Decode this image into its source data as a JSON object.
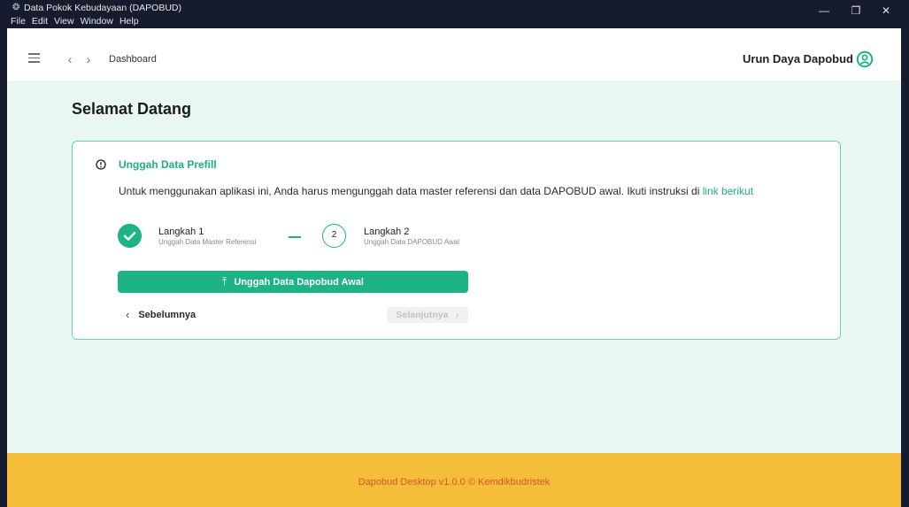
{
  "window": {
    "title": "Data Pokok Kebudayaan (DAPOBUD)",
    "menu": [
      "File",
      "Edit",
      "View",
      "Window",
      "Help"
    ],
    "controls": {
      "minimize_icon": "—",
      "restore_icon": "❐",
      "close_icon": "✕"
    }
  },
  "header": {
    "breadcrumb": "Dashboard",
    "user_label": "Urun Daya Dapobud",
    "icons": {
      "menu": "hamburger-icon",
      "back": "‹",
      "forward": "›",
      "user": "user-circle-icon"
    }
  },
  "main": {
    "title": "Selamat Datang",
    "card": {
      "title": "Unggah Data Prefill",
      "description": "Untuk menggunakan aplikasi ini, Anda harus mengunggah data master referensi dan data DAPOBUD awal. Ikuti instruksi di ",
      "link_text": "link berikut",
      "steps": [
        {
          "label": "Langkah 1",
          "sub": "Unggah Data Master Referensi",
          "status": "done"
        },
        {
          "number": "2",
          "label": "Langkah 2",
          "sub": "Unggah Data DAPOBUD Awal",
          "status": "active"
        }
      ],
      "upload_button": "Unggah Data Dapobud Awal",
      "prev_button": "Sebelumnya",
      "next_button": "Selanjutnya",
      "chev_left": "‹",
      "chev_right": "›",
      "upload_icon": "⤒"
    }
  },
  "footer": {
    "text": "Dapobud Desktop v1.0.0 © Kemdikbudristek"
  },
  "colors": {
    "accent": "#1eb384",
    "main_bg": "#e9f7f2",
    "footer_bg": "#f5be3a",
    "footer_text": "#d9542a",
    "titlebar_bg": "#161b2e"
  }
}
